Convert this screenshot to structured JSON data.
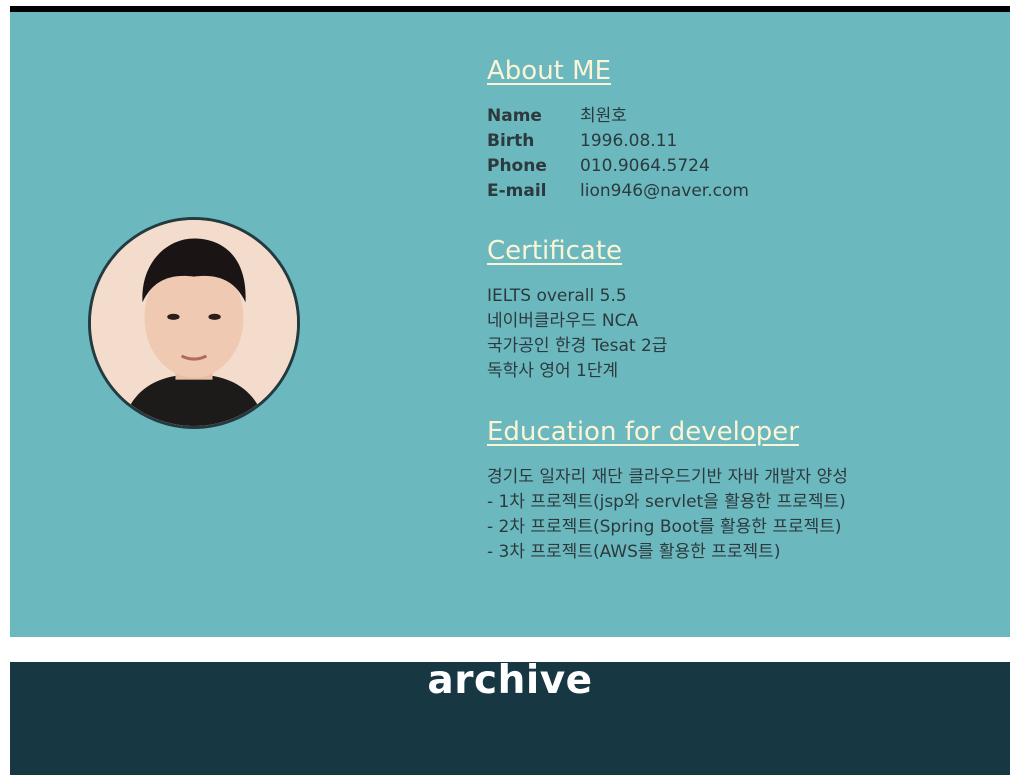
{
  "about": {
    "title": "About ME",
    "fields": [
      {
        "label": "Name",
        "value": "최원호"
      },
      {
        "label": "Birth",
        "value": "1996.08.11"
      },
      {
        "label": "Phone",
        "value": "010.9064.5724"
      },
      {
        "label": "E-mail",
        "value": "lion946@naver.com"
      }
    ]
  },
  "certificate": {
    "title": "Certificate",
    "items": [
      "IELTS overall 5.5",
      "네이버클라우드 NCA",
      "국가공인 한경 Tesat 2급",
      "독학사 영어 1단계"
    ]
  },
  "education": {
    "title": "Education for developer",
    "items": [
      "경기도 일자리 재단 클라우드기반 자바 개발자 양성",
      "- 1차 프로젝트(jsp와 servlet을 활용한 프로젝트)",
      "- 2차 프로젝트(Spring Boot를 활용한 프로젝트)",
      "- 3차 프로젝트(AWS를 활용한 프로젝트)"
    ]
  },
  "archive": {
    "title": "archive"
  },
  "colors": {
    "about_bg": "#6cb8bf",
    "title_color": "#fbf4d6",
    "archive_bg": "#173743"
  }
}
